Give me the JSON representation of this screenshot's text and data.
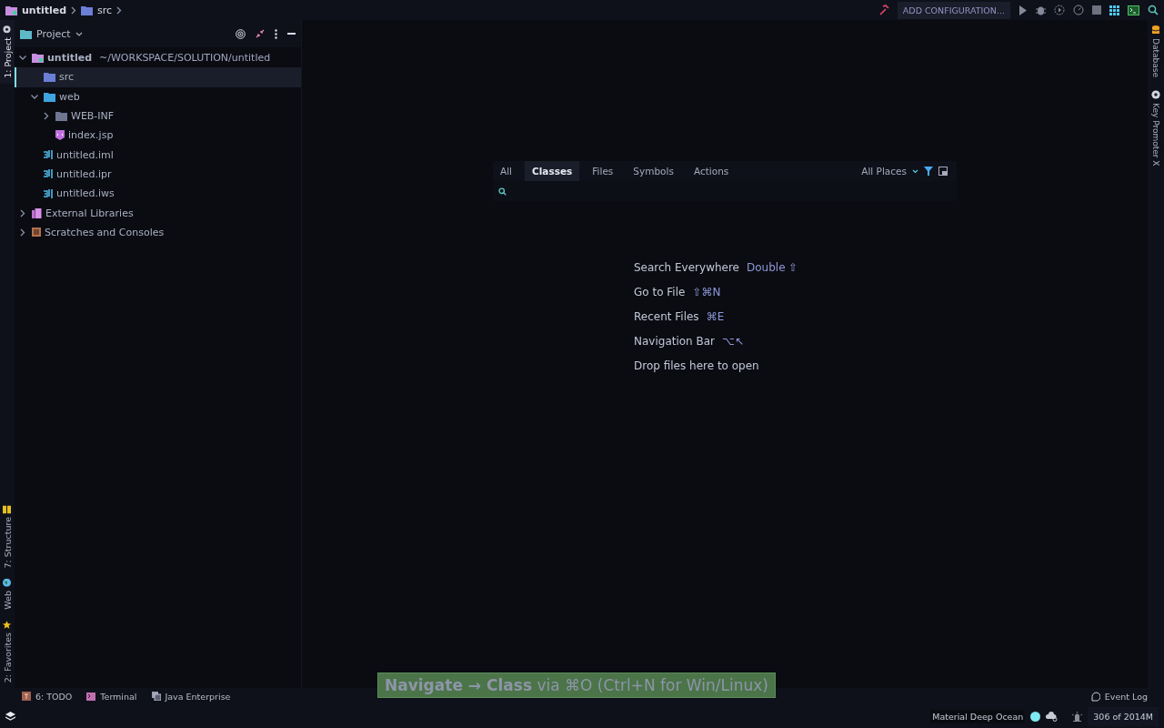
{
  "breadcrumbs": [
    {
      "label": "untitled",
      "kind": "project"
    },
    {
      "label": "src",
      "kind": "src"
    }
  ],
  "toolbar": {
    "configuration": "ADD CONFIGURATION..."
  },
  "left_strip": {
    "top": [
      {
        "label": "1: Project",
        "selected": true
      }
    ],
    "bottom": [
      {
        "label": "7: Structure",
        "kind": "structure"
      },
      {
        "label": "Web",
        "kind": "web"
      },
      {
        "label": "2: Favorites",
        "kind": "favorites"
      }
    ]
  },
  "right_strip": [
    {
      "label": "Database",
      "kind": "database"
    },
    {
      "label": "Key Promoter X",
      "kind": "keypromoter"
    }
  ],
  "project_panel": {
    "title": "Project",
    "tree": [
      {
        "label": "untitled",
        "path": "~/WORKSPACE/SOLUTION/untitled",
        "kind": "project",
        "expanded": true,
        "selected": false,
        "children": [
          {
            "label": "src",
            "kind": "src",
            "selected": true
          },
          {
            "label": "web",
            "kind": "web",
            "expanded": true,
            "selected": false,
            "children": [
              {
                "label": "WEB-INF",
                "kind": "folder",
                "expanded": false,
                "selected": false
              },
              {
                "label": "index.jsp",
                "kind": "jsp",
                "selected": false
              }
            ]
          },
          {
            "label": "untitled.iml",
            "kind": "ij",
            "selected": false
          },
          {
            "label": "untitled.ipr",
            "kind": "ij",
            "selected": false
          },
          {
            "label": "untitled.iws",
            "kind": "ij",
            "selected": false
          }
        ]
      },
      {
        "label": "External Libraries",
        "kind": "library",
        "expanded": false,
        "selected": false
      },
      {
        "label": "Scratches and Consoles",
        "kind": "scratch",
        "expanded": false,
        "selected": false
      }
    ]
  },
  "search_popup": {
    "tabs": [
      {
        "label": "All",
        "selected": false
      },
      {
        "label": "Classes",
        "selected": true
      },
      {
        "label": "Files",
        "selected": false
      },
      {
        "label": "Symbols",
        "selected": false
      },
      {
        "label": "Actions",
        "selected": false
      }
    ],
    "scope": "All Places"
  },
  "hints": [
    {
      "label": "Search Everywhere",
      "shortcut": "Double ⇧"
    },
    {
      "label": "Go to File",
      "shortcut": "⇧⌘N"
    },
    {
      "label": "Recent Files",
      "shortcut": "⌘E"
    },
    {
      "label": "Navigation Bar",
      "shortcut": "⌥↖"
    },
    {
      "label": "Drop files here to open"
    }
  ],
  "tip": "**Navigate → Class** via ⌘O (Ctrl+N for Win/Linux)",
  "bottom_tools": [
    {
      "label": "6: TODO",
      "kind": "todo"
    },
    {
      "label": "Terminal",
      "kind": "terminal"
    },
    {
      "label": "Java Enterprise",
      "kind": "javaee"
    }
  ],
  "event_log": "Event Log",
  "status_bar": {
    "theme": "Material Deep Ocean",
    "memory": "306 of 2014M"
  }
}
